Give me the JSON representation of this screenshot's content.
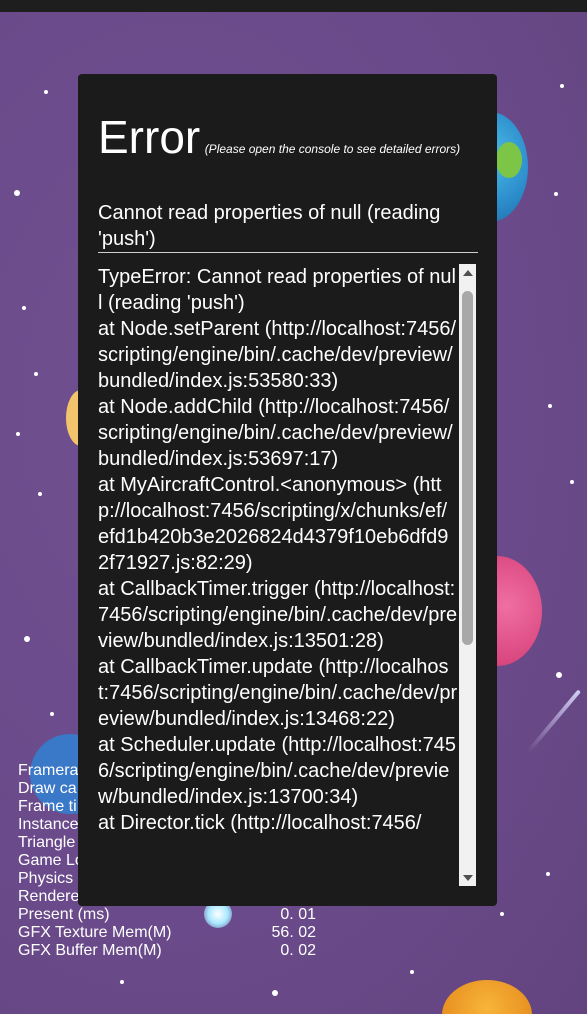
{
  "colors": {
    "background": "#6a4a8a",
    "dialog": "#1b1b1b",
    "text": "#ffffff"
  },
  "error": {
    "title": "Error",
    "note": "(Please open the console to see detailed errors)",
    "message": "Cannot read properties of null (reading 'push')",
    "trace": [
      "TypeError: Cannot read properties of null (reading 'push')",
      "at Node.setParent (http://localhost:7456/scripting/engine/bin/.cache/dev/preview/bundled/index.js:53580:33)",
      "at Node.addChild (http://localhost:7456/scripting/engine/bin/.cache/dev/preview/bundled/index.js:53697:17)",
      "at MyAircraftControl.<anonymous> (http://localhost:7456/scripting/x/chunks/ef/efd1b420b3e2026824d4379f10eb6dfd92f71927.js:82:29)",
      "at CallbackTimer.trigger (http://localhost:7456/scripting/engine/bin/.cache/dev/preview/bundled/index.js:13501:28)",
      "at CallbackTimer.update (http://localhost:7456/scripting/engine/bin/.cache/dev/preview/bundled/index.js:13468:22)",
      "at Scheduler.update (http://localhost:7456/scripting/engine/bin/.cache/dev/preview/bundled/index.js:13700:34)",
      "at Director.tick (http://localhost:7456/"
    ]
  },
  "stats": [
    {
      "label": "Framerate",
      "value": ""
    },
    {
      "label": "Draw ca",
      "value": ""
    },
    {
      "label": "Frame ti",
      "value": ""
    },
    {
      "label": "Instance",
      "value": ""
    },
    {
      "label": "Triangle",
      "value": ""
    },
    {
      "label": "Game Lo",
      "value": ""
    },
    {
      "label": "Physics",
      "value": ""
    },
    {
      "label": "Rendere",
      "value": ""
    },
    {
      "label": "Present (ms)",
      "value": "0. 01"
    },
    {
      "label": "GFX Texture Mem(M)",
      "value": "56. 02"
    },
    {
      "label": "GFX Buffer Mem(M)",
      "value": "0. 02"
    }
  ]
}
